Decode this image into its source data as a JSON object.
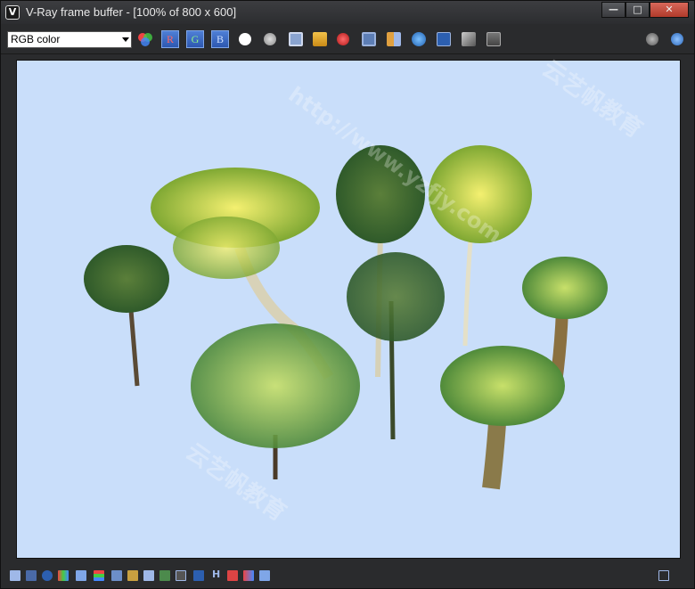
{
  "window": {
    "title": "V-Ray frame buffer - [100% of 800 x 600]",
    "app_icon_glyph": "V",
    "controls": {
      "minimize": "—",
      "maximize": "□",
      "close": "✕"
    }
  },
  "toolbar": {
    "channel_select": {
      "value": "RGB color"
    },
    "channel_buttons": {
      "r": "R",
      "g": "G",
      "b": "B"
    },
    "icons": [
      "color-wheel-icon",
      "red-channel",
      "green-channel",
      "blue-channel",
      "white-dot-icon",
      "gray-dot-icon",
      "save-icon",
      "open-folder-icon",
      "clear-icon",
      "copy-icon",
      "region-icon",
      "teapot-icon",
      "compare-icon",
      "lut-icon",
      "levels-icon",
      "settings-icon",
      "stop-icon"
    ]
  },
  "bottombar": {
    "h_label": "H"
  },
  "watermark": {
    "cn": "云艺帆教育",
    "url": "http://www.yzfjy.com"
  }
}
